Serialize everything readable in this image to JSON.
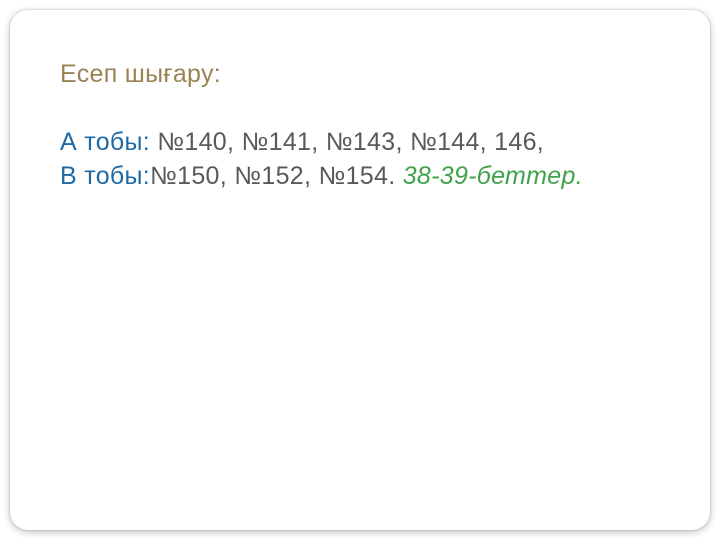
{
  "heading": "Есеп  шығару:",
  "group_a": {
    "label": "А тобы: ",
    "items": "№140,  №141,  №143, №144, 146,"
  },
  "group_b": {
    "label": "В тобы:",
    "items": "№150, №152, №154.      "
  },
  "pages": "38-39-беттер."
}
